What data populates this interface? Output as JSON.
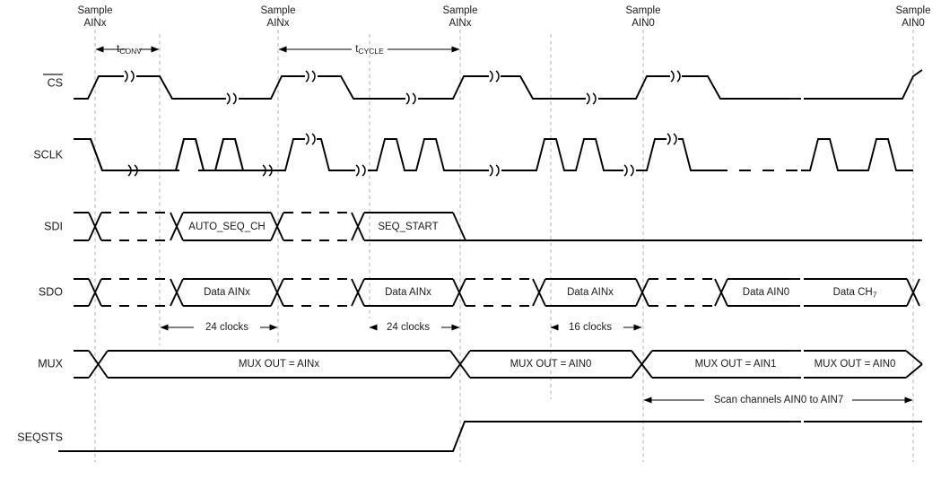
{
  "figure": {
    "kind": "spi-adc-timing-diagram",
    "background_color": "#ffffff",
    "wave_color": "#000000",
    "guide_color": "#b3b3b3"
  },
  "signals": [
    {
      "name": "cs",
      "label": "CS",
      "overline": true
    },
    {
      "name": "sclk",
      "label": "SCLK",
      "overline": false
    },
    {
      "name": "sdi",
      "label": "SDI",
      "overline": false
    },
    {
      "name": "sdo",
      "label": "SDO",
      "overline": false
    },
    {
      "name": "mux",
      "label": "MUX",
      "overline": false
    },
    {
      "name": "seqsts",
      "label": "SEQSTS",
      "overline": false
    }
  ],
  "sample_markers": [
    {
      "line1": "Sample",
      "line2": "AINx"
    },
    {
      "line1": "Sample",
      "line2": "AINx"
    },
    {
      "line1": "Sample",
      "line2": "AINx"
    },
    {
      "line1": "Sample",
      "line2": "AIN0"
    },
    {
      "line1": "Sample",
      "line2": "AIN0"
    }
  ],
  "timing_annotations": [
    {
      "name": "t-conv",
      "base": "t",
      "sub": "CONV"
    },
    {
      "name": "t-cycle",
      "base": "t",
      "sub": "CYCLE"
    }
  ],
  "sdi_packets": [
    {
      "label": "AUTO_SEQ_CH"
    },
    {
      "label": "SEQ_START"
    }
  ],
  "sdo_packets": [
    {
      "label": "Data AINx"
    },
    {
      "label": "Data AINx"
    },
    {
      "label": "Data AINx"
    },
    {
      "label": "Data AIN0"
    },
    {
      "label": "Data CH",
      "sub": "7"
    }
  ],
  "clock_counts": [
    {
      "label": "24 clocks"
    },
    {
      "label": "24 clocks"
    },
    {
      "label": "16 clocks"
    }
  ],
  "mux_states": [
    {
      "label": "MUX OUT = AINx"
    },
    {
      "label": "MUX OUT = AIN0"
    },
    {
      "label": "MUX OUT = AIN1"
    },
    {
      "label": "MUX OUT = AIN0"
    }
  ],
  "scan_annotation": {
    "label": "Scan channels AIN0 to AIN7"
  }
}
